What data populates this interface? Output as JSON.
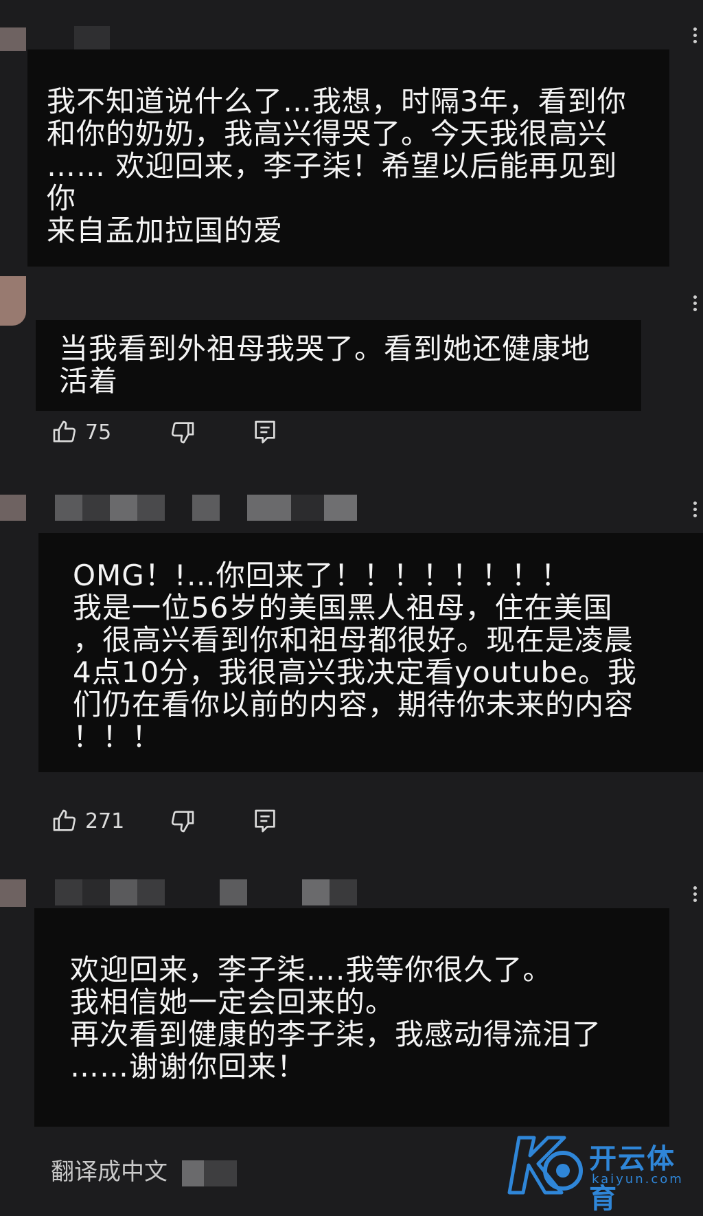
{
  "comments": [
    {
      "text": "我不知道说什么了…我想，时隔3年，看到你\n和你的奶奶，我高兴得哭了。今天我很高兴\n…… 欢迎回来，李子柒！希望以后能再见到\n你\n来自孟加拉国的爱"
    },
    {
      "text": "当我看到外祖母我哭了。看到她还健康地\n活着",
      "likes": "75"
    },
    {
      "text": "OMG！!…你回来了！！！！！！！！\n我是一位56岁的美国黑人祖母，住在美国\n，很高兴看到你和祖母都很好。现在是凌晨\n4点10分，我很高兴我决定看youtube。我\n们仍在看你以前的内容，期待你未来的内容\n！！！",
      "likes": "271"
    },
    {
      "text": "欢迎回来，李子柒….我等你很久了。\n我相信她一定会回来的。\n再次看到健康的李子柒，我感动得流泪了\n……谢谢你回来！"
    }
  ],
  "footer": {
    "translate_label": "翻译成中文"
  },
  "watermark": {
    "brand_text": "开云体育",
    "brand_sub": "kaiyun.com",
    "accent": "#2f86d8"
  },
  "icons": [
    "thumbs-up-icon",
    "thumbs-down-icon",
    "reply-icon",
    "more-vertical-icon"
  ]
}
